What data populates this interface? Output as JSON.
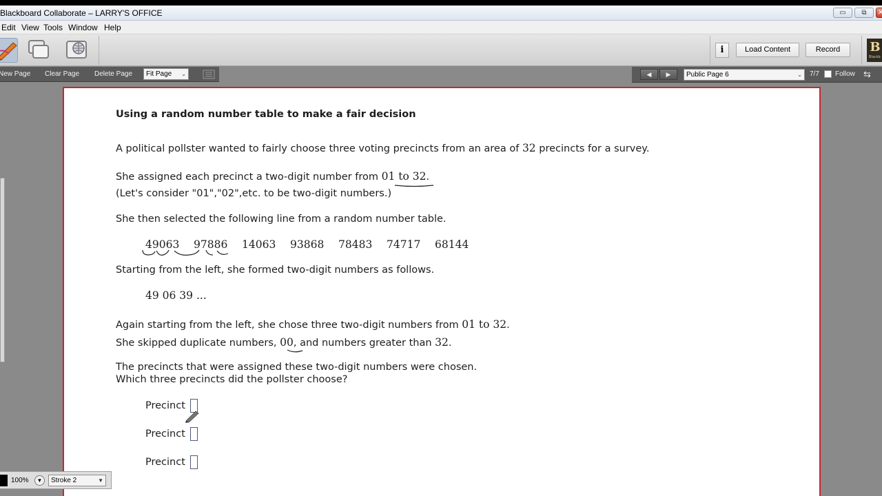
{
  "window": {
    "title": "Blackboard Collaborate – LARRY'S OFFICE",
    "controls": {
      "minimize": "▭",
      "restore": "⧉",
      "close": "✕"
    }
  },
  "menu": [
    "Edit",
    "View",
    "Tools",
    "Window",
    "Help"
  ],
  "toolbar": {
    "info_label": "i",
    "load_content": "Load Content",
    "record": "Record",
    "logo_letter": "B",
    "logo_text": "Blackb"
  },
  "whiteboard_bar": {
    "new_page": "New Page",
    "clear_page": "Clear Page",
    "delete_page": "Delete Page",
    "fit_page": "Fit Page"
  },
  "page_nav": {
    "current_page": "Public Page 6",
    "page_count": "7/7",
    "follow": "Follow"
  },
  "content": {
    "heading": "Using a random number table to make a fair decision",
    "intro_pre": "A political pollster wanted to fairly choose three voting precincts from an area of ",
    "intro_num": "32",
    "intro_post": " precincts for a survey.",
    "assign_pre": "She assigned each precinct a two-digit number from ",
    "assign_num": "01 to 32",
    "assign_post": ".",
    "consider": "(Let's consider \"01\",\"02\",etc. to be two-digit numbers.)",
    "selected": "She then selected the following line from a random number table.",
    "random_numbers": [
      "49063",
      "97886",
      "14063",
      "93868",
      "78483",
      "74717",
      "68144"
    ],
    "starting": "Starting from the left, she formed two-digit numbers as follows.",
    "formed": "49  06  39 ...",
    "again_pre": "Again starting from the left, she chose three two-digit numbers from ",
    "again_num": "01 to 32",
    "again_post": ".",
    "skipped_pre": "She skipped duplicate numbers, ",
    "skipped_num": "00",
    "skipped_mid": ", and numbers greater than ",
    "skipped_num2": "32",
    "skipped_post": ".",
    "assigned": "The precincts that were assigned these two-digit numbers were chosen.",
    "question": "Which three precincts did the pollster choose?",
    "answer_label": "Precinct"
  },
  "bottom_bar": {
    "zoom": "100%",
    "stroke": "Stroke 2"
  },
  "colors": {
    "page_border": "#c9252c",
    "ink": "#1d1d1d",
    "bar_dark": "#5a5a5a"
  }
}
